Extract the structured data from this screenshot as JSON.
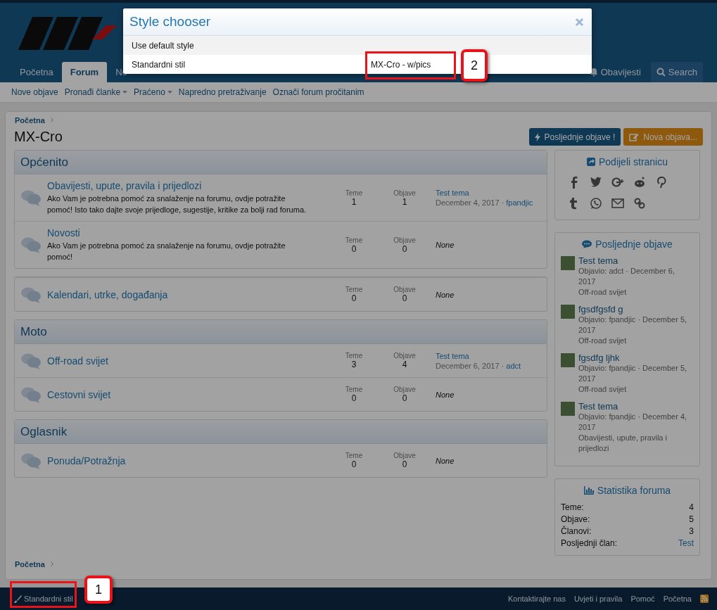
{
  "header": {
    "nav_tabs": [
      {
        "label": "Početna",
        "selected": false
      },
      {
        "label": "Forum",
        "selected": true
      },
      {
        "label": "No",
        "selected": false
      }
    ],
    "nav_right": [
      {
        "label": "Obavijesti",
        "kind": "bell"
      },
      {
        "label": "Search",
        "kind": "search"
      }
    ]
  },
  "subnav": [
    {
      "label": "Nove objave",
      "dropdown": false
    },
    {
      "label": "Pronađi članke",
      "dropdown": true
    },
    {
      "label": "Praćeno",
      "dropdown": true
    },
    {
      "label": "Napredno pretraživanje",
      "dropdown": false
    },
    {
      "label": "Označi forum pročitanim",
      "dropdown": false
    }
  ],
  "breadcrumb": "Početna",
  "page_title": "MX-Cro",
  "buttons": [
    {
      "label": "Posljednje objave !",
      "kind": "bolt"
    },
    {
      "label": "Nova objava...",
      "kind": "edit"
    }
  ],
  "categories": [
    {
      "title": "Općenito",
      "forums": [
        {
          "title": "Obavijesti, upute, pravila i prijedlozi",
          "description": "Ako Vam je potrebna pomoć za snalaženje na forumu, ovdje potražite pomoć! Isto tako dajte svoje prijedloge, sugestije, kritike za bolji rad foruma.",
          "stats": [
            {
              "label": "Teme",
              "value": "1"
            },
            {
              "label": "Objave",
              "value": "1"
            }
          ],
          "latest": {
            "title": "Test tema",
            "date": "December 4, 2017 ·",
            "user": "fpandjic"
          }
        },
        {
          "title": "Novosti",
          "description": "Ako Vam je potrebna pomoć za snalaženje na forumu, ovdje potražite pomoć!",
          "stats": [
            {
              "label": "Teme",
              "value": "0"
            },
            {
              "label": "Objave",
              "value": "0"
            }
          ],
          "none": "None"
        }
      ]
    },
    {
      "forums": [
        {
          "title": "Kalendari, utrke, događanja",
          "stats": [
            {
              "label": "Teme",
              "value": "0"
            },
            {
              "label": "Objave",
              "value": "0"
            }
          ],
          "none": "None"
        }
      ]
    },
    {
      "title": "Moto",
      "forums": [
        {
          "title": "Off-road svijet",
          "stats": [
            {
              "label": "Teme",
              "value": "3"
            },
            {
              "label": "Objave",
              "value": "4"
            }
          ],
          "latest": {
            "title": "Test tema",
            "date": "December 6, 2017 ·",
            "user": "adct"
          }
        },
        {
          "title": "Cestovni svijet",
          "stats": [
            {
              "label": "Teme",
              "value": "0"
            },
            {
              "label": "Objave",
              "value": "0"
            }
          ],
          "none": "None"
        }
      ]
    },
    {
      "title": "Oglasnik",
      "forums": [
        {
          "title": "Ponuda/Potražnja",
          "stats": [
            {
              "label": "Teme",
              "value": "0"
            },
            {
              "label": "Objave",
              "value": "0"
            }
          ],
          "none": "None"
        }
      ]
    }
  ],
  "sidebar": {
    "share": {
      "title": "Podijeli stranicu"
    },
    "latest_posts": {
      "title": "Posljednje objave",
      "items": [
        {
          "title": "Test tema",
          "meta": "Objavio: adct · December 6, 2017",
          "forum": "Off-road svijet"
        },
        {
          "title": "fgsdfgsfd g",
          "meta": "Objavio: fpandjic · December 5, 2017",
          "forum": "Off-road svijet"
        },
        {
          "title": "fgsdfg ljhk",
          "meta": "Objavio: fpandjic · December 5, 2017",
          "forum": "Off-road svijet"
        },
        {
          "title": "Test tema",
          "meta": "Objavio: fpandjic · December 4, 2017",
          "forum": "Obavijesti, upute, pravila i prijedlozi"
        }
      ]
    },
    "stats": {
      "title": "Statistika foruma",
      "rows": [
        {
          "label": "Teme:",
          "value": "4",
          "link": false
        },
        {
          "label": "Objave:",
          "value": "5",
          "link": false
        },
        {
          "label": "Članovi:",
          "value": "3",
          "link": false
        },
        {
          "label": "Posljednji član:",
          "value": "Test",
          "link": true
        }
      ]
    }
  },
  "bottom_breadcrumb": "Početna",
  "footer": {
    "style_link": "Standardni stil",
    "links": [
      "Kontaktirajte nas",
      "Uvjeti i pravila",
      "Pomoć",
      "Početna"
    ]
  },
  "modal": {
    "title": "Style chooser",
    "rows": [
      {
        "cells": [
          "Use default style"
        ],
        "selected": true
      },
      {
        "cells": [
          "Standardni stil",
          "MX-Cro - w/pics"
        ],
        "selected": false
      }
    ]
  },
  "annotations": [
    {
      "number": "1"
    },
    {
      "number": "2"
    }
  ]
}
